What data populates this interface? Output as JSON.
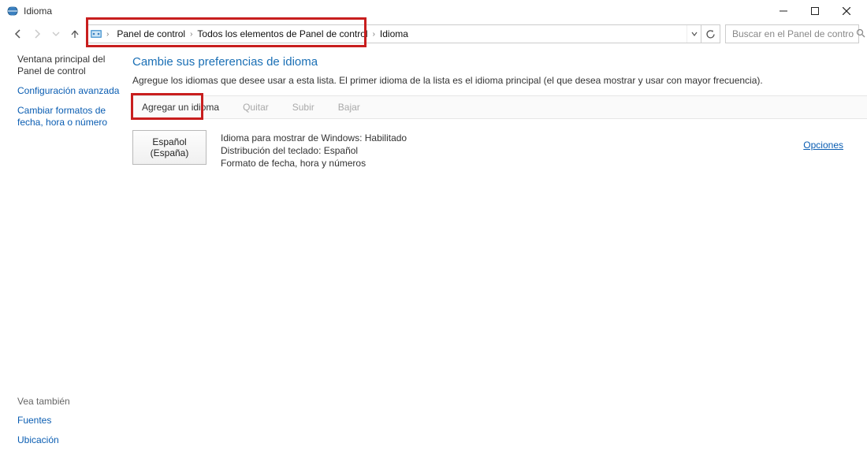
{
  "window": {
    "title": "Idioma"
  },
  "breadcrumb": {
    "segments": [
      "Panel de control",
      "Todos los elementos de Panel de control",
      "Idioma"
    ]
  },
  "search": {
    "placeholder": "Buscar en el Panel de control"
  },
  "sidebar": {
    "home": "Ventana principal del Panel de control",
    "links": [
      "Configuración avanzada",
      "Cambiar formatos de fecha, hora o número"
    ],
    "see_also_label": "Vea también",
    "see_also": [
      "Fuentes",
      "Ubicación"
    ]
  },
  "main": {
    "heading": "Cambie sus preferencias de idioma",
    "description": "Agregue los idiomas que desee usar a esta lista. El primer idioma de la lista es el idioma principal (el que desea mostrar y usar con mayor frecuencia).",
    "toolbar": {
      "add": "Agregar un idioma",
      "remove": "Quitar",
      "up": "Subir",
      "down": "Bajar"
    },
    "language": {
      "name": "Español (España)",
      "line1": "Idioma para mostrar de Windows: Habilitado",
      "line2": "Distribución del teclado: Español",
      "line3": "Formato de fecha, hora y números",
      "options": "Opciones"
    }
  }
}
